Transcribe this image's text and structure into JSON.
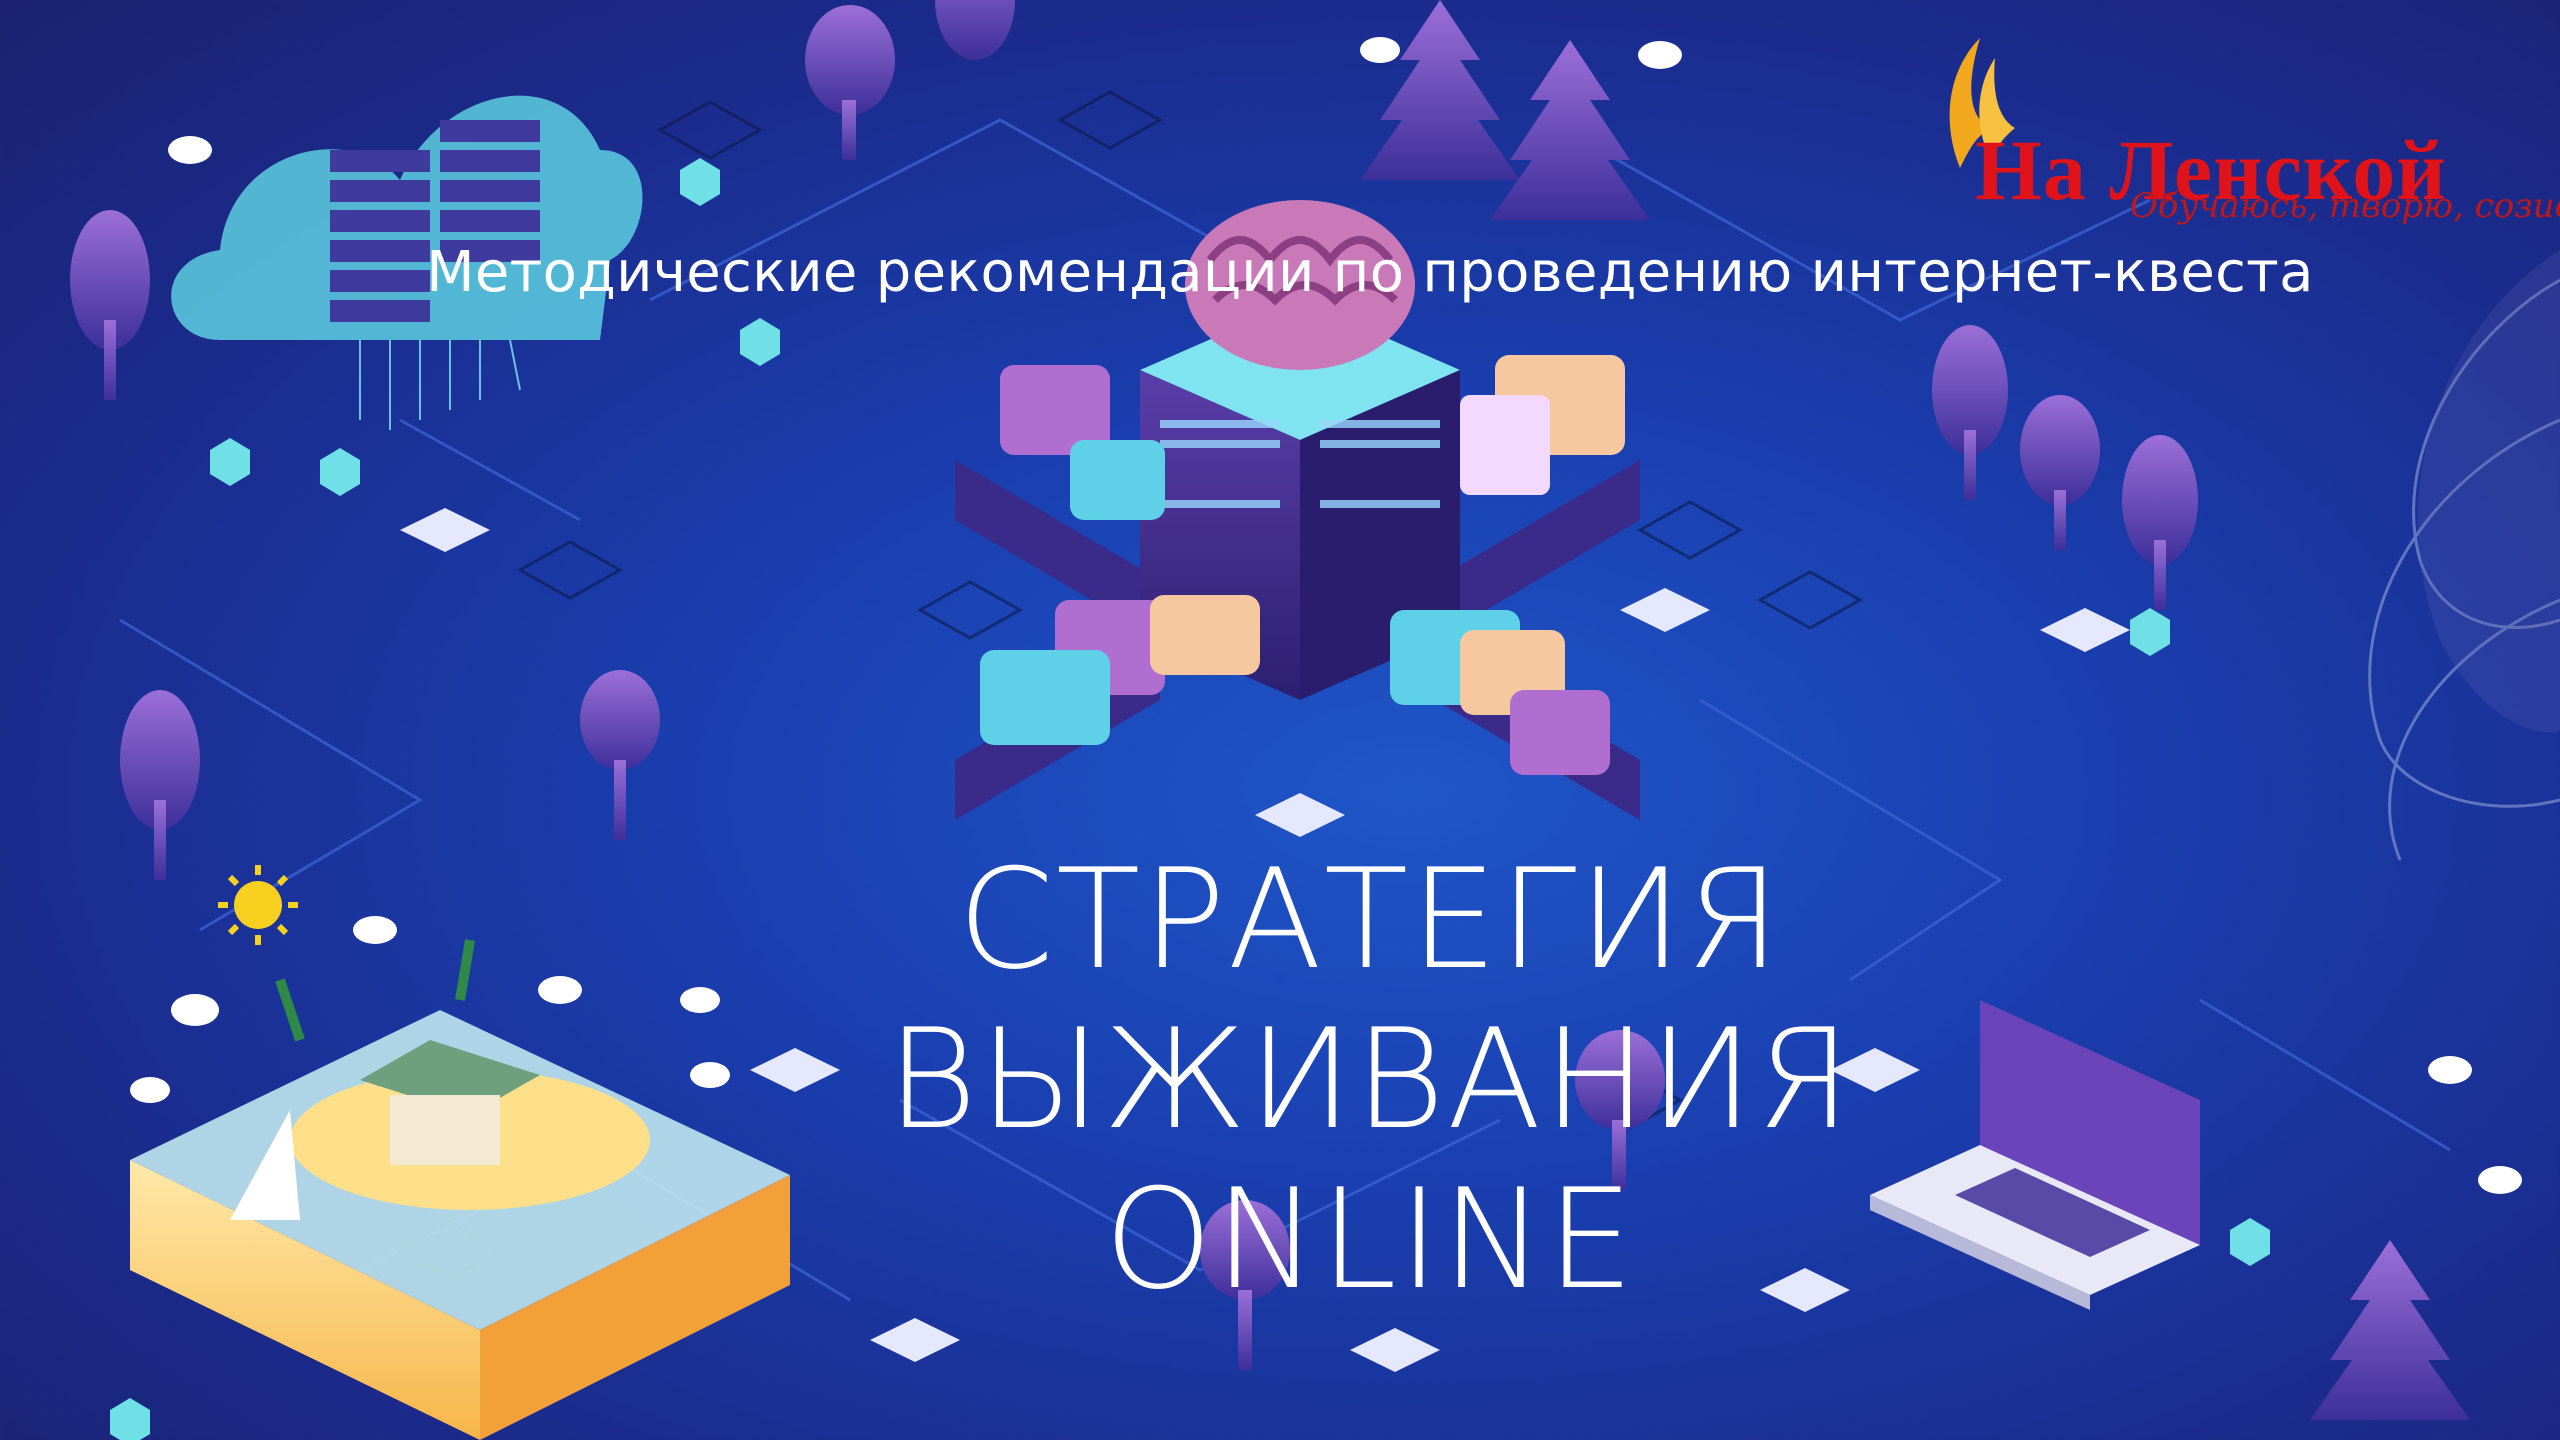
{
  "slide": {
    "subtitle": "Методические рекомендации по проведению интернет-квеста",
    "title_line1": "СТРАТЕГИЯ ВЫЖИВАНИЯ",
    "title_line2": "ONLINE"
  },
  "logo": {
    "name": "На Ленской",
    "tagline": "Обучаюсь, творю, созидаю"
  },
  "icons": [
    "cloud-server-icon",
    "brain-hub-icon",
    "island-icon",
    "laptop-icon",
    "sun-icon",
    "tree-icon",
    "wing-icon"
  ],
  "colors": {
    "background": "#1b3aa8",
    "accent_cyan": "#5fd7e8",
    "accent_purple": "#6a3fb8",
    "logo_red": "#e0131b",
    "logo_gold": "#f2a81d"
  }
}
